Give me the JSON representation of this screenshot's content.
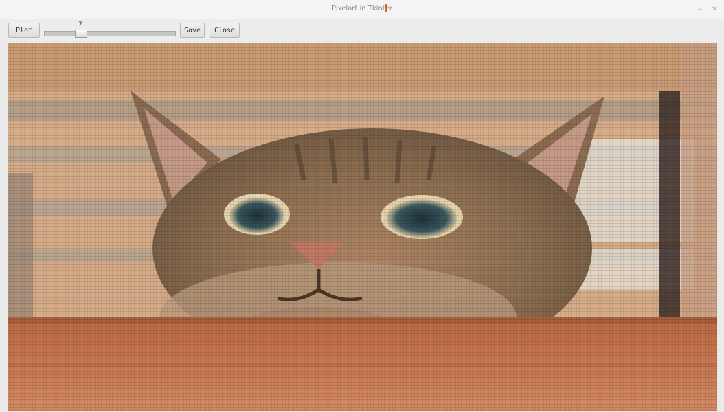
{
  "window": {
    "title": "Pixelart in Tkinter",
    "minimize_glyph": "–",
    "close_glyph": "✕"
  },
  "toolbar": {
    "plot_label": "Plot",
    "save_label": "Save",
    "close_label": "Close",
    "scale_value": "7",
    "scale_min": 1,
    "scale_max": 50
  },
  "canvas": {
    "content": "pixelated-photo",
    "colors": {
      "wall": "#d8b190",
      "fur": "#8d6f52",
      "table": "#c3704a",
      "eye": "#2f4a50",
      "nose": "#c07a64"
    }
  }
}
